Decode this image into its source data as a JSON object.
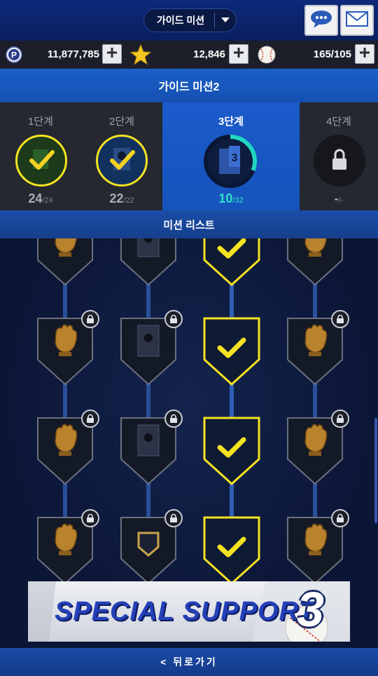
{
  "header": {
    "mode_selector": "가이드 미션",
    "icons": [
      "chat-icon",
      "mail-icon"
    ]
  },
  "currency": {
    "points": "11,877,785",
    "stars": "12,846",
    "balls": "165/105"
  },
  "title": "가이드 미션2",
  "stages": [
    {
      "name": "1단계",
      "done": "24",
      "total": "/24",
      "status": "complete"
    },
    {
      "name": "2단계",
      "done": "22",
      "total": "/22",
      "status": "complete"
    },
    {
      "name": "3단계",
      "done": "10",
      "total": "/32",
      "status": "current",
      "progress": 0.31
    },
    {
      "name": "4단계",
      "done": "-",
      "total": "/-",
      "status": "locked"
    }
  ],
  "mission_list_label": "미션 리스트",
  "banner": {
    "title": "SPECIAL SUPPORT",
    "number": "3"
  },
  "back_label": "< 뒤로가기",
  "colors": {
    "accent_yellow": "#f5e321",
    "progress_teal": "#1fd6c0",
    "title_blue": "#1a5fc8"
  }
}
